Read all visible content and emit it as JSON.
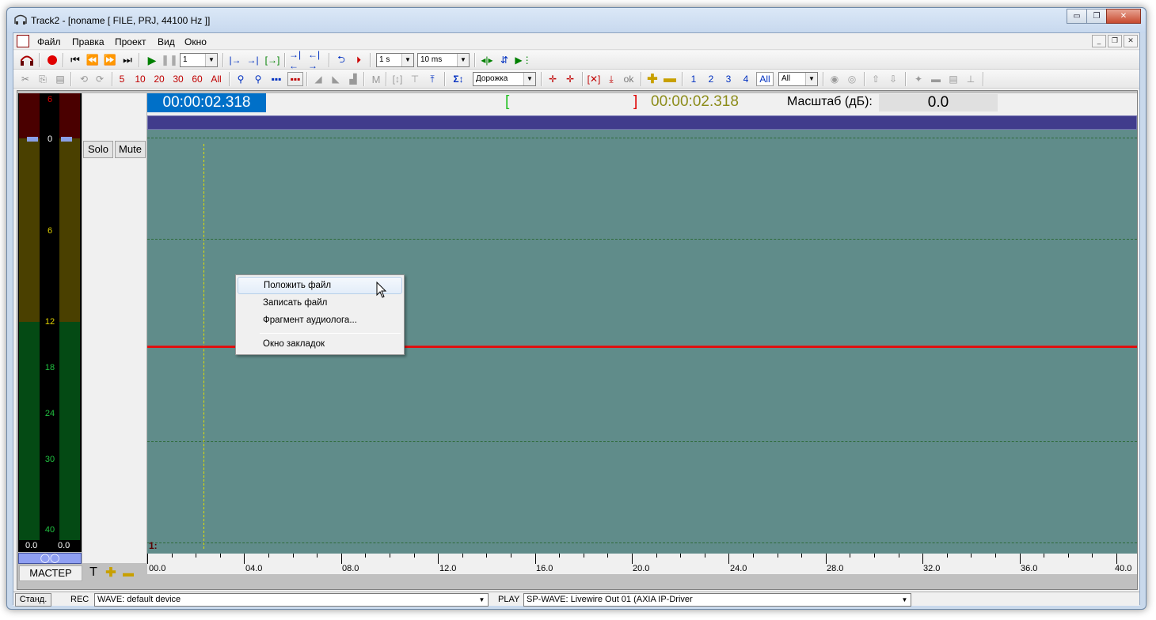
{
  "window": {
    "title": "Track2 - [noname [ FILE, PRJ, 44100 Hz ]]",
    "minimize_glyph": "▭",
    "restore_glyph": "❐",
    "close_glyph": "✕"
  },
  "menubar": {
    "items": [
      "Файл",
      "Правка",
      "Проект",
      "Вид",
      "Окно"
    ],
    "mdi_minimize": "_",
    "mdi_restore": "❐",
    "mdi_close": "✕"
  },
  "toolbar1": {
    "count_value": "1",
    "step_value": "1 s",
    "fine_step_value": "10 ms"
  },
  "toolbar2": {
    "undo_label": "⟲",
    "redo_label": "⟳",
    "zoom_presets": [
      "5",
      "10",
      "20",
      "30",
      "60",
      "All"
    ],
    "mark_label": "M",
    "sum_label": "Σ↕",
    "track_mode_value": "Дорожка",
    "ok_label": "ok",
    "track_numbers": [
      "1",
      "2",
      "3",
      "4",
      "All"
    ],
    "track_filter_value": "All"
  },
  "meters": {
    "scale_ticks": [
      "6",
      "0",
      "6",
      "12",
      "18",
      "24",
      "30",
      "40"
    ],
    "left_value": "0.0",
    "right_value": "0.0",
    "link_symbol": "◯◯",
    "master_label": "МАСТЕР"
  },
  "track_header": {
    "solo_label": "Solo",
    "mute_label": "Mute",
    "track_number": "1:"
  },
  "info_bar": {
    "current_time": "00:00:02.318",
    "bracket_open": "[",
    "bracket_close": "]",
    "selection_time": "00:00:02.318",
    "scale_label": "Масштаб (дБ):",
    "scale_value": "0.0"
  },
  "ruler": {
    "labels": [
      "00.0",
      "04.0",
      "08.0",
      "12.0",
      "16.0",
      "20.0",
      "24.0",
      "28.0",
      "32.0",
      "36.0",
      "40.0"
    ]
  },
  "context_menu": {
    "items": [
      "Положить файл",
      "Записать файл",
      "Фрагмент аудиолога...",
      "Окно закладок"
    ]
  },
  "statusbar": {
    "mode_button": "Станд.",
    "rec_label": "REC",
    "rec_device": "WAVE: default device",
    "play_label": "PLAY",
    "play_device": "SP-WAVE: Livewire Out 01 (AXIA IP-Driver"
  },
  "colors": {
    "waveform_bg": "#608c8a",
    "time_highlight": "#0070c8",
    "red_line": "#e01010",
    "overview": "#403c8c"
  }
}
